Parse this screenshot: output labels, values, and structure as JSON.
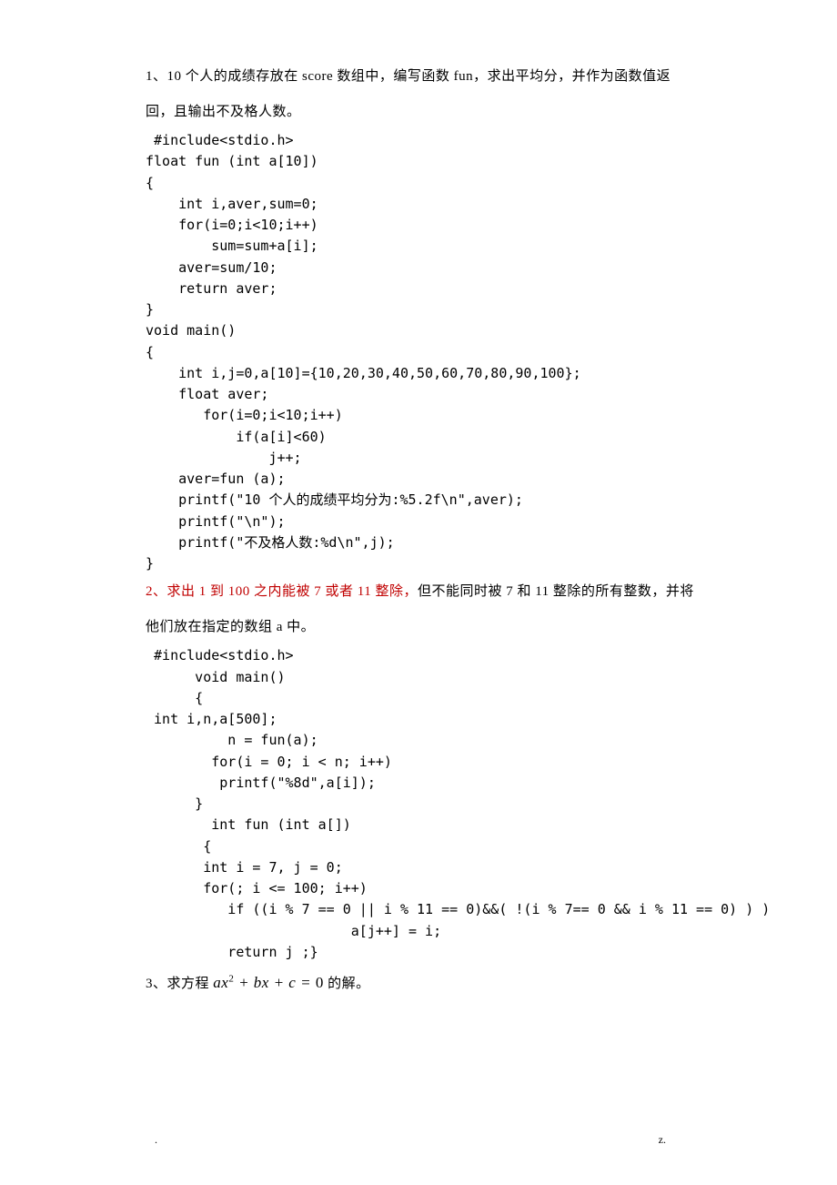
{
  "top_mark": "-",
  "problem1": {
    "title": " 1、10 个人的成绩存放在 score 数组中，编写函数 fun，求出平均分，并作为函数值返回，且输出不及格人数。",
    "code": " #include<stdio.h>\nfloat fun (int a[10])\n{\n    int i,aver,sum=0;\n    for(i=0;i<10;i++)\n        sum=sum+a[i];\n    aver=sum/10;\n    return aver;\n}\nvoid main()\n{\n    int i,j=0,a[10]={10,20,30,40,50,60,70,80,90,100};\n    float aver;\n       for(i=0;i<10;i++)\n           if(a[i]<60)\n               j++;\n    aver=fun (a);\n    printf(\"10 个人的成绩平均分为:%5.2f\\n\",aver);\n    printf(\"\\n\");\n    printf(\"不及格人数:%d\\n\",j);\n}"
  },
  "problem2": {
    "title_red": "2、求出 1 到 100 之内能被 7 或者 11 整除，",
    "title_rest": "但不能同时被 7 和 11 整除的所有整数，并将他们放在指定的数组 a 中。",
    "code": " #include<stdio.h>\n      void main()\n      {\n int i,n,a[500];\n          n = fun(a);\n        for(i = 0; i < n; i++)\n         printf(\"%8d\",a[i]);\n      }\n        int fun (int a[])\n       {\n       int i = 7, j = 0;\n       for(; i <= 100; i++)\n          if ((i % 7 == 0 || i % 11 == 0)&&( !(i % 7== 0 && i % 11 == 0) ) )\n                         a[j++] = i;\n          return j ;}"
  },
  "problem3": {
    "prefix": "3、求方程 ",
    "eq_a": "ax",
    "eq_exp": "2",
    "eq_mid": " + bx + c = ",
    "eq_zero": "0",
    "suffix": " 的解。"
  },
  "footer_left": ".",
  "footer_right": "z."
}
